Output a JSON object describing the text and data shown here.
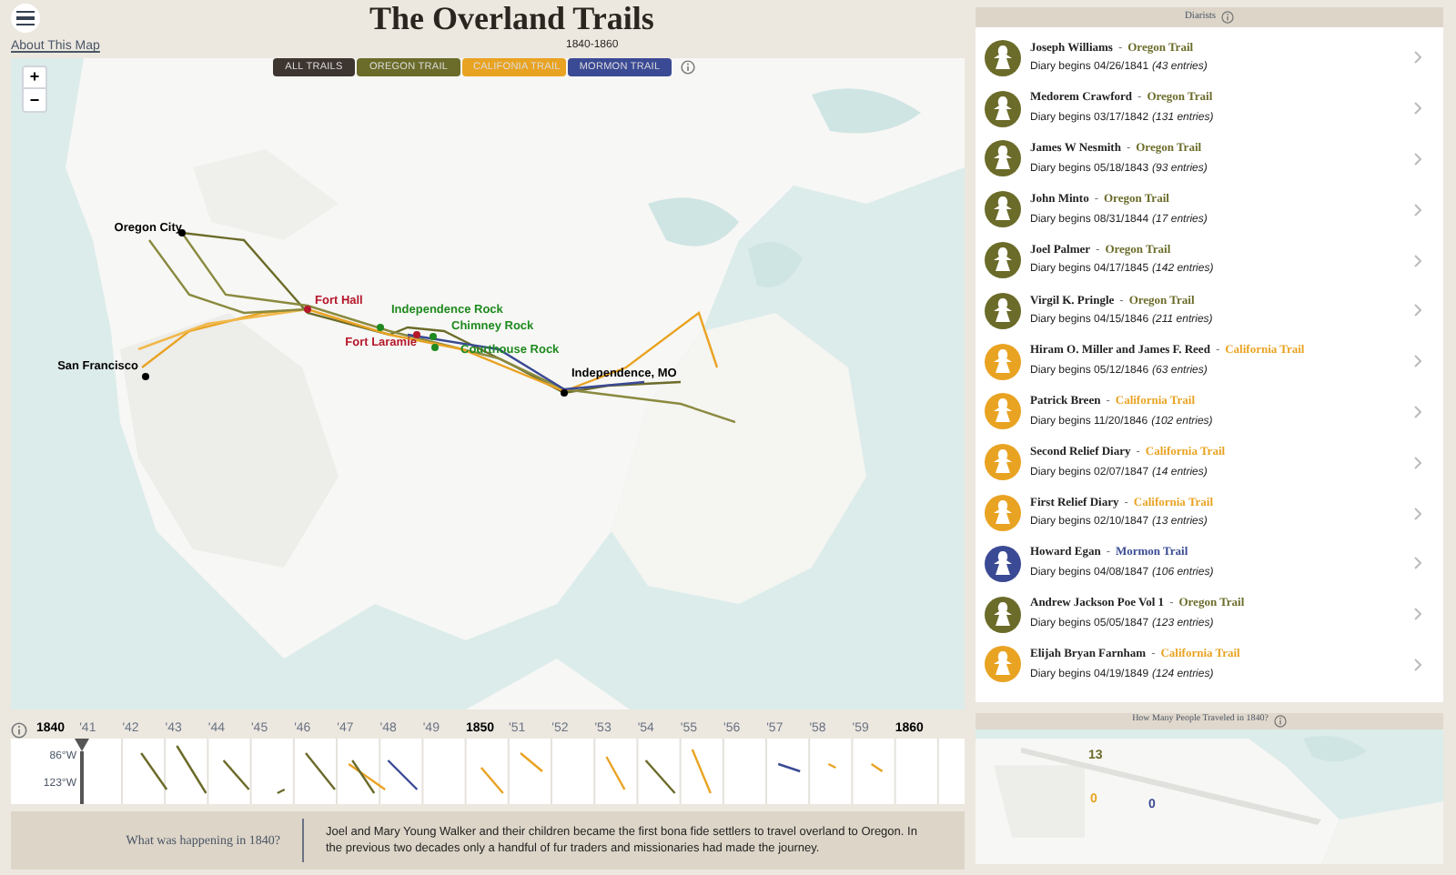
{
  "header": {
    "title": "The Overland Trails",
    "subtitle": "1840-1860",
    "about_link": "About This Map"
  },
  "trail_filters": [
    {
      "label": "ALL TRAILS",
      "color": "#3d3530"
    },
    {
      "label": "OREGON TRAIL",
      "color": "#6b6b2a"
    },
    {
      "label": "CALIFONIA TRAIL",
      "color": "#e9a322"
    },
    {
      "label": "MORMON TRAIL",
      "color": "#3a4a94"
    }
  ],
  "map": {
    "zoom_in": "+",
    "zoom_out": "−",
    "places": [
      {
        "name": "Oregon City",
        "kind": "city"
      },
      {
        "name": "Fort Hall",
        "kind": "fort"
      },
      {
        "name": "Independence Rock",
        "kind": "landmark"
      },
      {
        "name": "Chimney Rock",
        "kind": "landmark"
      },
      {
        "name": "Fort Laramie",
        "kind": "fort"
      },
      {
        "name": "Courthouse Rock",
        "kind": "landmark"
      },
      {
        "name": "San Francisco",
        "kind": "city"
      },
      {
        "name": "Independence, MO",
        "kind": "city"
      }
    ]
  },
  "timeline": {
    "longitudes": [
      "86°W",
      "123°W"
    ],
    "years": [
      {
        "label": "1840",
        "kind": "decade"
      },
      {
        "label": "'41",
        "kind": "year"
      },
      {
        "label": "'42",
        "kind": "year"
      },
      {
        "label": "'43",
        "kind": "year"
      },
      {
        "label": "'44",
        "kind": "year"
      },
      {
        "label": "'45",
        "kind": "year"
      },
      {
        "label": "'46",
        "kind": "year"
      },
      {
        "label": "'47",
        "kind": "year"
      },
      {
        "label": "'48",
        "kind": "year"
      },
      {
        "label": "'49",
        "kind": "year"
      },
      {
        "label": "1850",
        "kind": "decade"
      },
      {
        "label": "'51",
        "kind": "year"
      },
      {
        "label": "'52",
        "kind": "year"
      },
      {
        "label": "'53",
        "kind": "year"
      },
      {
        "label": "'54",
        "kind": "year"
      },
      {
        "label": "'55",
        "kind": "year"
      },
      {
        "label": "'56",
        "kind": "year"
      },
      {
        "label": "'57",
        "kind": "year"
      },
      {
        "label": "'58",
        "kind": "year"
      },
      {
        "label": "'59",
        "kind": "year"
      },
      {
        "label": "1860",
        "kind": "decade"
      }
    ]
  },
  "happening": {
    "question": "What was happening in 1840?",
    "text": "Joel and Mary Young Walker and their children became the first bona fide settlers to travel overland to Oregon. In the previous two decades only a handful of fur traders and missionaries had made the journey."
  },
  "diarists": {
    "title": "Diarists",
    "items": [
      {
        "name": "Joseph Williams",
        "separator": "-",
        "trail": "Oregon Trail",
        "color": "#6b6b2a",
        "begins": "Diary begins 04/26/1841",
        "entries": "(43 entries)"
      },
      {
        "name": "Medorem Crawford",
        "separator": "-",
        "trail": "Oregon Trail",
        "color": "#6b6b2a",
        "begins": "Diary begins 03/17/1842",
        "entries": "(131 entries)"
      },
      {
        "name": "James W Nesmith",
        "separator": "-",
        "trail": "Oregon Trail",
        "color": "#6b6b2a",
        "begins": "Diary begins 05/18/1843",
        "entries": "(93 entries)"
      },
      {
        "name": "John Minto",
        "separator": "-",
        "trail": "Oregon Trail",
        "color": "#6b6b2a",
        "begins": "Diary begins 08/31/1844",
        "entries": "(17 entries)"
      },
      {
        "name": "Joel Palmer",
        "separator": "-",
        "trail": "Oregon Trail",
        "color": "#6b6b2a",
        "begins": "Diary begins 04/17/1845",
        "entries": "(142 entries)"
      },
      {
        "name": "Virgil K. Pringle",
        "separator": "-",
        "trail": "Oregon Trail",
        "color": "#6b6b2a",
        "begins": "Diary begins 04/15/1846",
        "entries": "(211 entries)"
      },
      {
        "name": "Hiram O. Miller and James F. Reed",
        "separator": "-",
        "trail": "California Trail",
        "color": "#e9a322",
        "begins": "Diary begins 05/12/1846",
        "entries": "(63 entries)"
      },
      {
        "name": "Patrick Breen",
        "separator": "-",
        "trail": "California Trail",
        "color": "#e9a322",
        "begins": "Diary begins 11/20/1846",
        "entries": "(102 entries)"
      },
      {
        "name": "Second Relief Diary",
        "separator": "-",
        "trail": "California Trail",
        "color": "#e9a322",
        "begins": "Diary begins 02/07/1847",
        "entries": "(14 entries)"
      },
      {
        "name": "First Relief Diary",
        "separator": "-",
        "trail": "California Trail",
        "color": "#e9a322",
        "begins": "Diary begins 02/10/1847",
        "entries": "(13 entries)"
      },
      {
        "name": "Howard Egan",
        "separator": "-",
        "trail": "Mormon Trail",
        "color": "#3a4a94",
        "begins": "Diary begins 04/08/1847",
        "entries": "(106 entries)"
      },
      {
        "name": "Andrew Jackson Poe Vol 1",
        "separator": "-",
        "trail": "Oregon Trail",
        "color": "#6b6b2a",
        "begins": "Diary begins 05/05/1847",
        "entries": "(123 entries)"
      },
      {
        "name": "Elijah Bryan Farnham",
        "separator": "-",
        "trail": "California Trail",
        "color": "#e9a322",
        "begins": "Diary begins 04/19/1849",
        "entries": "(124 entries)"
      }
    ]
  },
  "travelers": {
    "title": "How Many People Traveled in 1840?",
    "counts": [
      {
        "value": "13",
        "color": "#6b6b2a"
      },
      {
        "value": "0",
        "color": "#e9a322"
      },
      {
        "value": "0",
        "color": "#3a4a94"
      }
    ]
  }
}
